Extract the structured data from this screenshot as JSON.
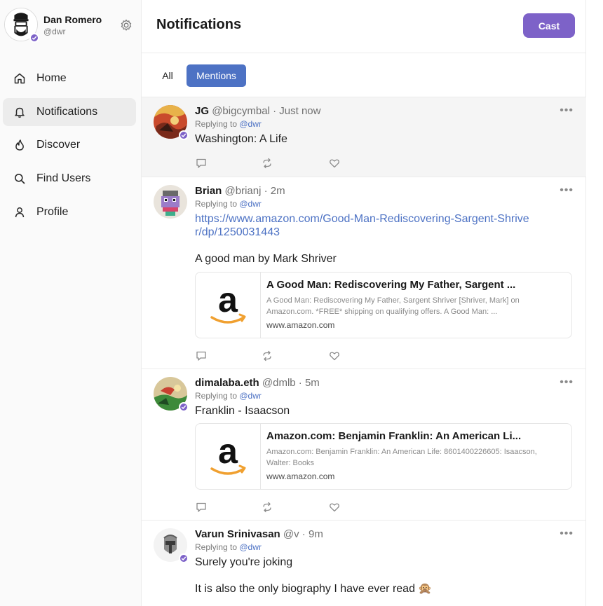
{
  "user": {
    "name": "Dan Romero",
    "handle": "@dwr"
  },
  "nav": {
    "items": [
      {
        "label": "Home",
        "icon": "home-icon"
      },
      {
        "label": "Notifications",
        "icon": "bell-icon"
      },
      {
        "label": "Discover",
        "icon": "flame-icon"
      },
      {
        "label": "Find Users",
        "icon": "search-icon"
      },
      {
        "label": "Profile",
        "icon": "user-icon"
      }
    ],
    "active": "Notifications"
  },
  "header": {
    "title": "Notifications",
    "cast_label": "Cast"
  },
  "tabs": {
    "all": "All",
    "mentions": "Mentions",
    "active": "Mentions"
  },
  "colors": {
    "accent": "#7d62c8",
    "tab_active": "#4d72c4",
    "link": "#4d72c4"
  },
  "posts": [
    {
      "name": "JG",
      "handle": "@bigcymbal",
      "time": " · Just now",
      "replying": "Replying to ",
      "reply_to": "@dwr",
      "text": "Washington: A Life"
    },
    {
      "name": "Brian",
      "handle": "@brianj",
      "time": " · 2m",
      "replying": "Replying to ",
      "reply_to": "@dwr",
      "link": "https://www.amazon.com/Good-Man-Rediscovering-Sargent-Shriver/dp/1250031443",
      "text": "A good man by Mark Shriver",
      "embed": {
        "title": "A Good Man: Rediscovering My Father, Sargent ...",
        "desc": "A Good Man: Rediscovering My Father, Sargent Shriver [Shriver, Mark] on Amazon.com. *FREE* shipping on qualifying offers. A Good Man: ...",
        "domain": "www.amazon.com"
      }
    },
    {
      "name": "dimalaba.eth",
      "handle": "@dmlb",
      "time": " · 5m",
      "replying": "Replying to ",
      "reply_to": "@dwr",
      "text": "Franklin - Isaacson",
      "embed": {
        "title": "Amazon.com: Benjamin Franklin: An American Li...",
        "desc": "Amazon.com: Benjamin Franklin: An American Life: 8601400226605: Isaacson, Walter: Books",
        "domain": "www.amazon.com"
      }
    },
    {
      "name": "Varun Srinivasan",
      "handle": "@v",
      "time": " · 9m",
      "replying": "Replying to ",
      "reply_to": "@dwr",
      "text": "Surely you're joking",
      "text2": "It is also the only biography I have ever read 🙊"
    }
  ]
}
